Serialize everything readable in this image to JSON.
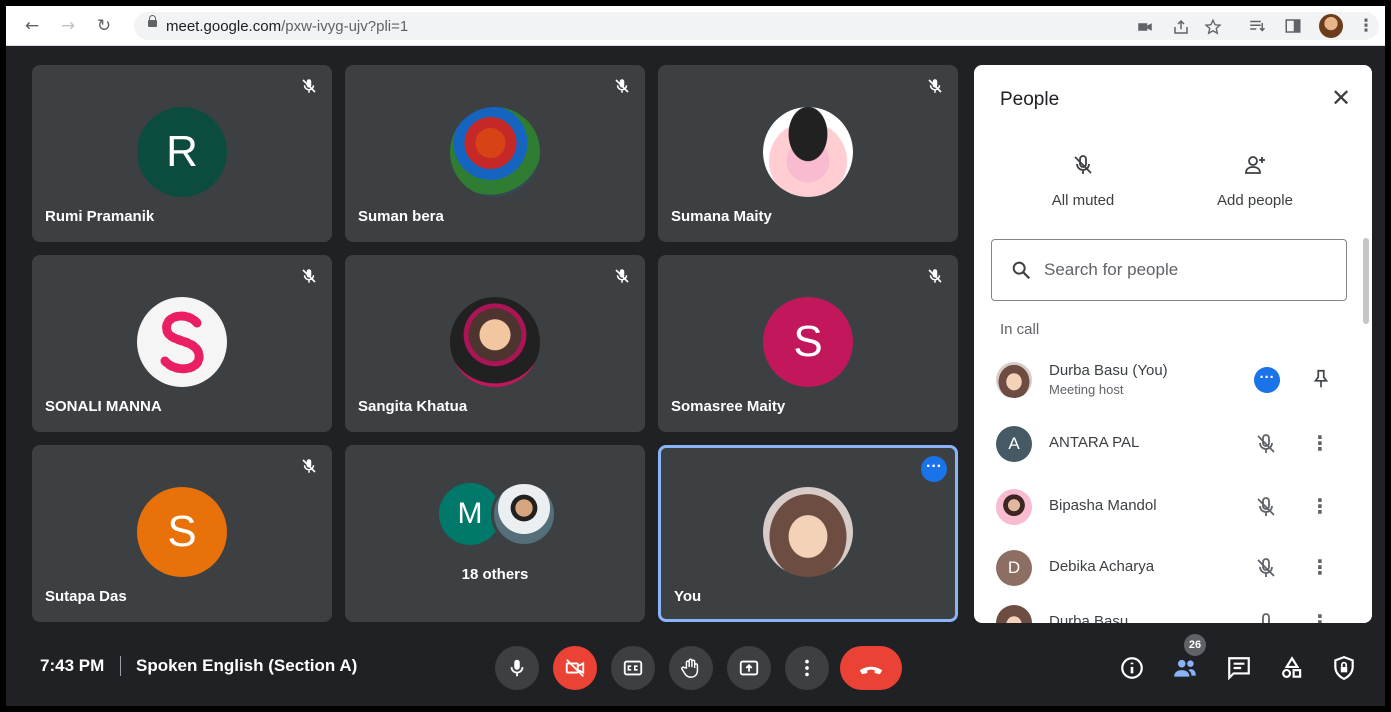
{
  "browser": {
    "url_host": "meet.google.com",
    "url_path": "/pxw-ivyg-ujv?pli=1"
  },
  "tiles": [
    {
      "name": "Rumi Pramanik",
      "initial": "R",
      "color": "#0b4c3f"
    },
    {
      "name": "Suman bera"
    },
    {
      "name": "Sumana Maity"
    },
    {
      "name": "SONALI MANNA"
    },
    {
      "name": "Sangita Khatua"
    },
    {
      "name": "Somasree Maity",
      "initial": "S",
      "color": "#c2185b"
    },
    {
      "name": "Sutapa Das",
      "initial": "S",
      "color": "#e8710a"
    },
    {
      "others_label": "18 others",
      "initial": "M",
      "color": "#00796b"
    },
    {
      "name": "You"
    }
  ],
  "people": {
    "title": "People",
    "all_muted": "All muted",
    "add_people": "Add people",
    "search_placeholder": "Search for people",
    "section": "In call",
    "list": [
      {
        "name": "Durba Basu (You)",
        "role": "Meeting host"
      },
      {
        "name": "ANTARA PAL",
        "initial": "A",
        "color": "#455a64"
      },
      {
        "name": "Bipasha Mandol"
      },
      {
        "name": "Debika Acharya",
        "initial": "D",
        "color": "#8d6e63"
      },
      {
        "name": "Durba Basu"
      }
    ]
  },
  "bottom": {
    "time": "7:43 PM",
    "meeting_title": "Spoken English (Section A)",
    "participant_count": "26"
  },
  "colors": {
    "accent_blue": "#1a73e8",
    "danger_red": "#ea4335",
    "dark_bg": "#202124",
    "tile_bg": "#3c4043"
  }
}
